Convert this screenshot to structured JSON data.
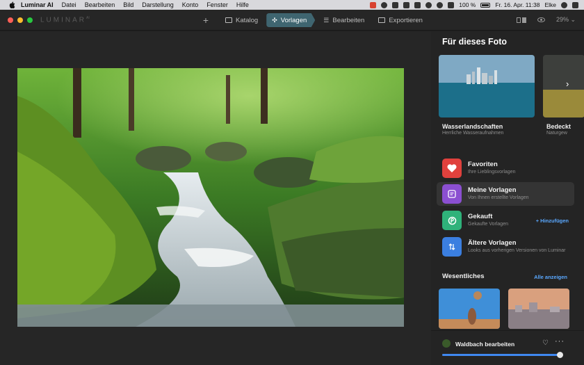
{
  "menubar": {
    "app": "Luminar AI",
    "items": [
      "Datei",
      "Bearbeiten",
      "Bild",
      "Darstellung",
      "Konto",
      "Fenster",
      "Hilfe"
    ],
    "battery": "100 %",
    "datetime": "Fr. 16. Apr.  11:38",
    "user": "Elke"
  },
  "toolbar": {
    "logo": "LUMINAR",
    "logo_sup": "AI",
    "tabs": [
      {
        "label": "Katalog",
        "icon": "folder-icon"
      },
      {
        "label": "Vorlagen",
        "icon": "templates-icon",
        "active": true
      },
      {
        "label": "Bearbeiten",
        "icon": "sliders-icon"
      },
      {
        "label": "Exportieren",
        "icon": "export-icon"
      }
    ],
    "zoom": "29%"
  },
  "panel": {
    "title": "Für dieses Foto",
    "cards": [
      {
        "name": "Wasserlandschaften",
        "sub": "Herrliche Wasseraufnahmen"
      },
      {
        "name": "Bedeckt",
        "sub": "Naturgew"
      }
    ],
    "categories": [
      {
        "name": "Favoriten",
        "sub": "Ihre Lieblingsvorlagen",
        "color": "#e0413d",
        "icon": "heart-icon"
      },
      {
        "name": "Meine Vorlagen",
        "sub": "Von Ihnen erstellte Vorlagen",
        "color": "#8b4fd1",
        "icon": "document-icon"
      },
      {
        "name": "Gekauft",
        "sub": "Gekaufte Vorlagen",
        "color": "#2fb27a",
        "icon": "bag-icon",
        "action": "+ Hinzufügen"
      },
      {
        "name": "Ältere Vorlagen",
        "sub": "Looks aus vorherigen Versionen von Luminar",
        "color": "#3b7fe0",
        "icon": "swap-icon"
      }
    ],
    "section": "Wesentliches",
    "show_all": "Alle anzeigen",
    "footer_title": "Waldbach bearbeiten",
    "slider_value": 1.0
  }
}
